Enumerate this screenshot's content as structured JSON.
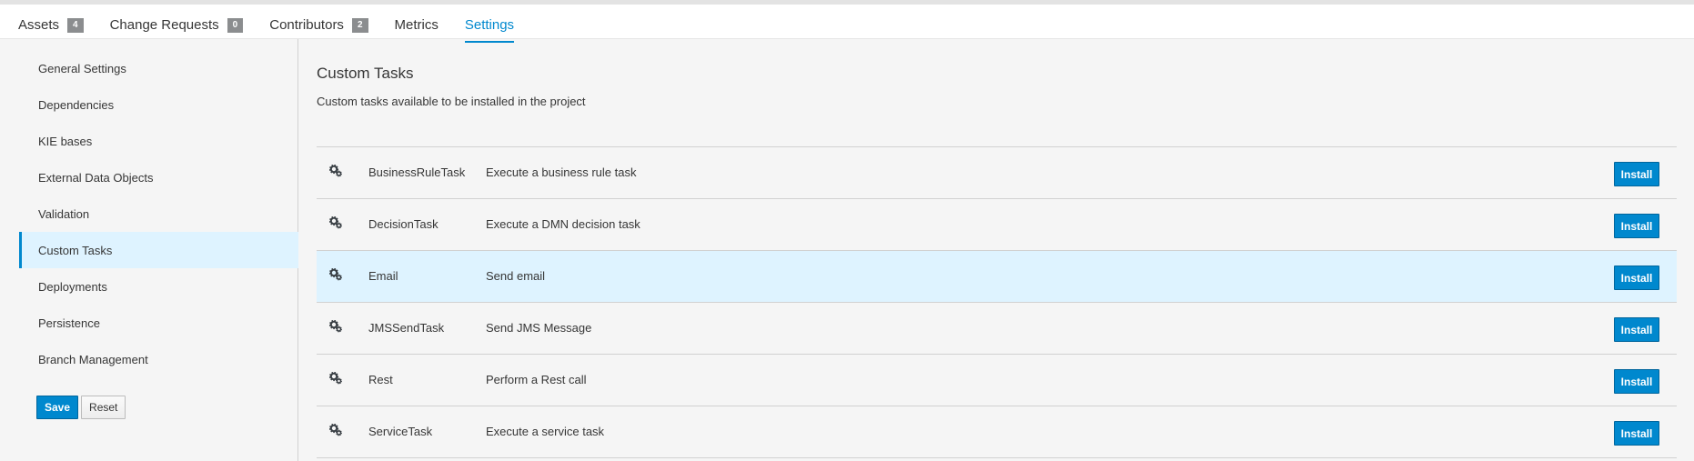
{
  "tabs": [
    {
      "label": "Assets",
      "badge": "4"
    },
    {
      "label": "Change Requests",
      "badge": "0"
    },
    {
      "label": "Contributors",
      "badge": "2"
    },
    {
      "label": "Metrics",
      "badge": ""
    },
    {
      "label": "Settings",
      "badge": ""
    }
  ],
  "active_tab": "Settings",
  "sidebar": {
    "items": [
      {
        "label": "General Settings"
      },
      {
        "label": "Dependencies"
      },
      {
        "label": "KIE bases"
      },
      {
        "label": "External Data Objects"
      },
      {
        "label": "Validation"
      },
      {
        "label": "Custom Tasks"
      },
      {
        "label": "Deployments"
      },
      {
        "label": "Persistence"
      },
      {
        "label": "Branch Management"
      }
    ],
    "active_item": "Custom Tasks",
    "save_label": "Save",
    "reset_label": "Reset"
  },
  "main": {
    "title": "Custom Tasks",
    "subtitle": "Custom tasks available to be installed in the project",
    "install_label": "Install",
    "tasks": [
      {
        "name": "BusinessRuleTask",
        "description": "Execute a business rule task",
        "icon": "gears-icon"
      },
      {
        "name": "DecisionTask",
        "description": "Execute a DMN decision task",
        "icon": "gears-icon"
      },
      {
        "name": "Email",
        "description": "Send email",
        "icon": "gears-icon"
      },
      {
        "name": "JMSSendTask",
        "description": "Send JMS Message",
        "icon": "gears-icon"
      },
      {
        "name": "Rest",
        "description": "Perform a Rest call",
        "icon": "gears-icon"
      },
      {
        "name": "ServiceTask",
        "description": "Execute a service task",
        "icon": "gears-icon"
      }
    ],
    "highlighted_task": "Email"
  },
  "colors": {
    "accent": "#0088ce",
    "highlight": "#def3ff",
    "badge": "#8b8d8f",
    "background": "#f5f5f5"
  }
}
